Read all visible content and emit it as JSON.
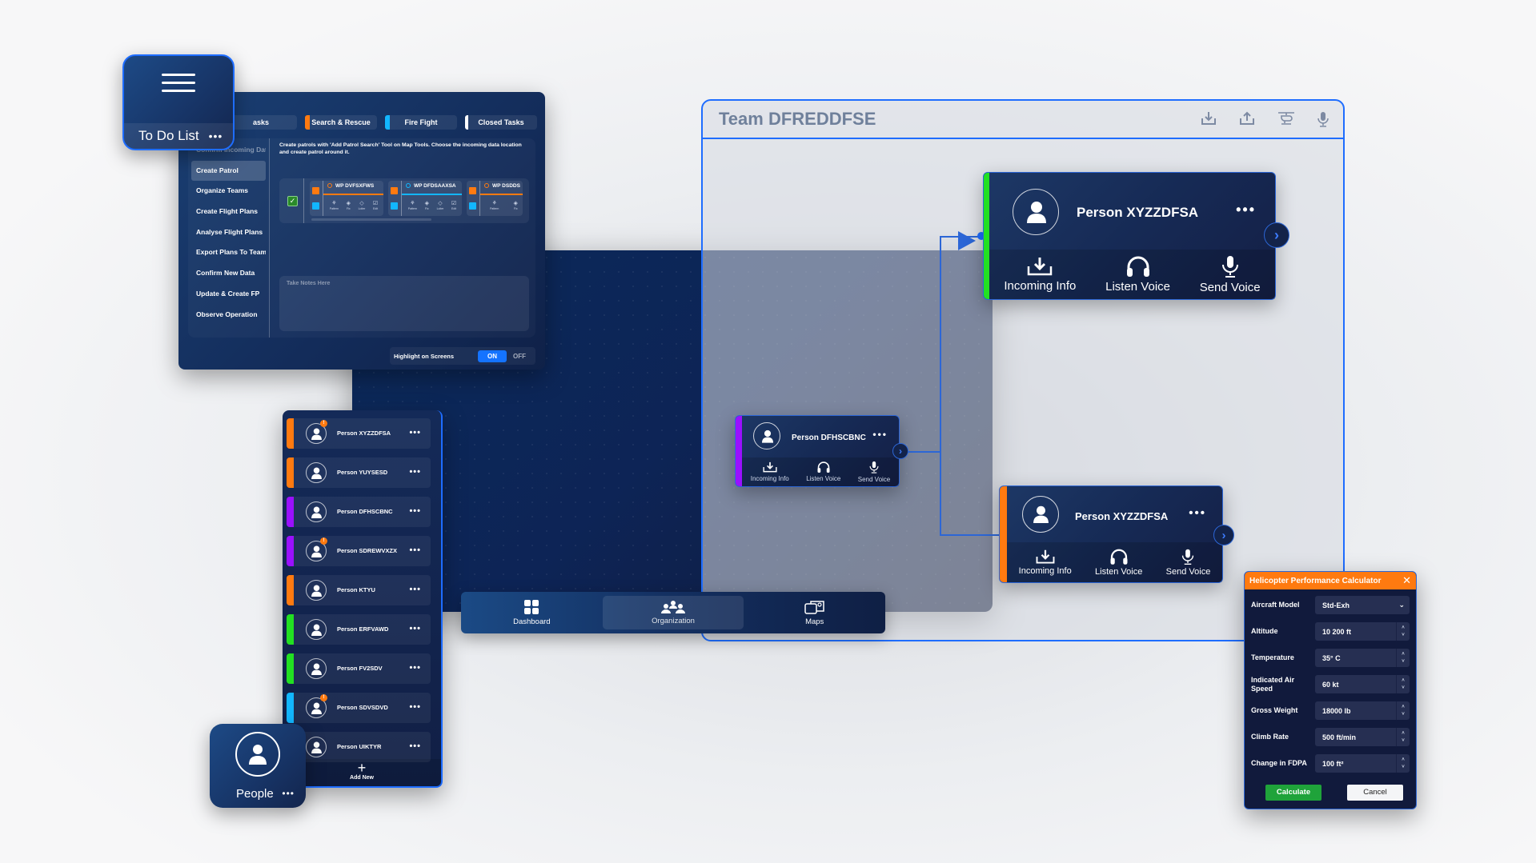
{
  "todo_tile": {
    "label": "To Do List",
    "more": "•••",
    "icon": "hamburger-menu-icon"
  },
  "todo_panel": {
    "tabs": [
      {
        "label": "Open Tasks",
        "visible_label": "asks",
        "color": ""
      },
      {
        "label": "Search & Rescue",
        "color": "#ff7a10"
      },
      {
        "label": "Fire Fight",
        "color": "#12b6ff"
      },
      {
        "label": "Closed Tasks",
        "color": "#ffffff"
      }
    ],
    "nav": [
      {
        "label": "Confirm Incoming Data",
        "state": "faded"
      },
      {
        "label": "Create Patrol",
        "state": "active"
      },
      {
        "label": "Organize Teams",
        "state": ""
      },
      {
        "label": "Create Flight Plans",
        "state": ""
      },
      {
        "label": "Analyse Flight Plans",
        "state": ""
      },
      {
        "label": "Export Plans To Teams",
        "state": ""
      },
      {
        "label": "Confirm New Data",
        "state": ""
      },
      {
        "label": "Update & Create FP",
        "state": ""
      },
      {
        "label": "Observe Operation",
        "state": ""
      }
    ],
    "instructions": "Create patrols with 'Add Patrol Search' Tool on Map Tools. Choose the incoming data location and create patrol around it.",
    "waypoints": [
      {
        "name": "WP DVFSXFWS",
        "color": "#ff7a10"
      },
      {
        "name": "WP DFDSAAXSA",
        "color": "#12b6ff"
      },
      {
        "name": "WP DSDDS",
        "color": "#ff7a10"
      }
    ],
    "waypoint_actions": [
      "Pattern",
      "Fix",
      "Loiter",
      "Edit"
    ],
    "notes_placeholder": "Take Notes Here",
    "highlight_label": "Highlight on Screens",
    "toggle_on": "ON",
    "toggle_off": "OFF",
    "toggle_state": "ON"
  },
  "people_list": {
    "items": [
      {
        "name": "Person XYZZDFSA",
        "color": "#ff7a10",
        "alert": true
      },
      {
        "name": "Person YUYSESD",
        "color": "#ff7a10",
        "alert": false
      },
      {
        "name": "Person DFHSCBNC",
        "color": "#9a10ff",
        "alert": false
      },
      {
        "name": "Person SDREWVXZX",
        "color": "#9a10ff",
        "alert": true
      },
      {
        "name": "Person KTYU",
        "color": "#ff7a10",
        "alert": false
      },
      {
        "name": "Person ERFVAWD",
        "color": "#22e022",
        "alert": false
      },
      {
        "name": "Person FV2SDV",
        "color": "#22e022",
        "alert": false
      },
      {
        "name": "Person SDVSDVD",
        "color": "#12b6ff",
        "alert": true
      },
      {
        "name": "Person UIKTYR",
        "color": "#9a10ff",
        "alert": false
      }
    ],
    "more": "•••",
    "alert_glyph": "!",
    "add_new": "Add New",
    "add_glyph": "+"
  },
  "people_tile": {
    "label": "People",
    "more": "•••"
  },
  "bottom_nav": [
    {
      "label": "Dashboard",
      "icon": "dashboard-grid-icon",
      "active": false
    },
    {
      "label": "Organization",
      "icon": "organization-people-icon",
      "active": true
    },
    {
      "label": "Maps",
      "icon": "maps-icon",
      "active": false
    }
  ],
  "team": {
    "title": "Team DFREDDFSE",
    "header_icons": [
      "download-icon",
      "upload-icon",
      "helicopter-icon",
      "microphone-icon"
    ],
    "cards": [
      {
        "name": "Person XYZZDFSA",
        "color": "#22e022"
      },
      {
        "name": "Person DFHSCBNC",
        "color": "#9a10ff"
      },
      {
        "name": "Person XYZZDFSA",
        "color": "#ff7a10"
      }
    ],
    "actions": [
      "Incoming Info",
      "Listen Voice",
      "Send Voice"
    ],
    "more": "•••",
    "chevron": "›"
  },
  "calculator": {
    "title": "Helicopter Performance Calculator",
    "close": "✕",
    "fields": [
      {
        "label": "Aircraft Model",
        "value": "Std-Exh",
        "type": "select"
      },
      {
        "label": "Altitude",
        "value": "10 200  ft",
        "type": "spin"
      },
      {
        "label": "Temperature",
        "value": "35°  C",
        "type": "spin"
      },
      {
        "label": "Indicated Air Speed",
        "value": "60   kt",
        "type": "spin"
      },
      {
        "label": "Gross Weight",
        "value": "18000  lb",
        "type": "spin"
      },
      {
        "label": "Climb Rate",
        "value": "500  ft/min",
        "type": "spin"
      },
      {
        "label": "Change in FDPA",
        "value": "100  ft²",
        "type": "spin"
      }
    ],
    "calculate": "Calculate",
    "cancel": "Cancel",
    "select_arrow": "⌄",
    "spin_up": "˄",
    "spin_down": "˅"
  }
}
